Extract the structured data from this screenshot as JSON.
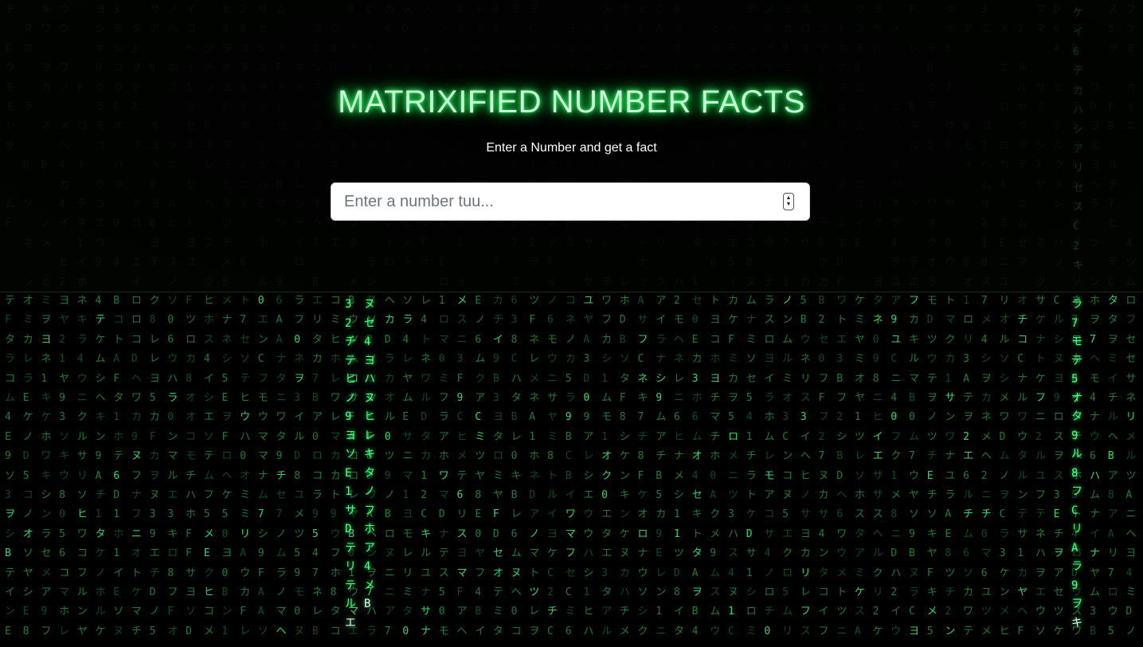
{
  "page": {
    "title": "MATRIXIFIED NUMBER FACTS",
    "subtitle": "Enter a Number and get a fact"
  },
  "number_input": {
    "placeholder": "Enter a number tuu...",
    "value": "",
    "stepper_up_icon": "chevron-up-icon",
    "stepper_down_icon": "chevron-down-icon"
  },
  "background": {
    "style": "matrix-digital-rain",
    "glyph_color": "#1e7a3a",
    "stream_color": "#4dff8a",
    "title_glow_color": "#3cff6e"
  }
}
